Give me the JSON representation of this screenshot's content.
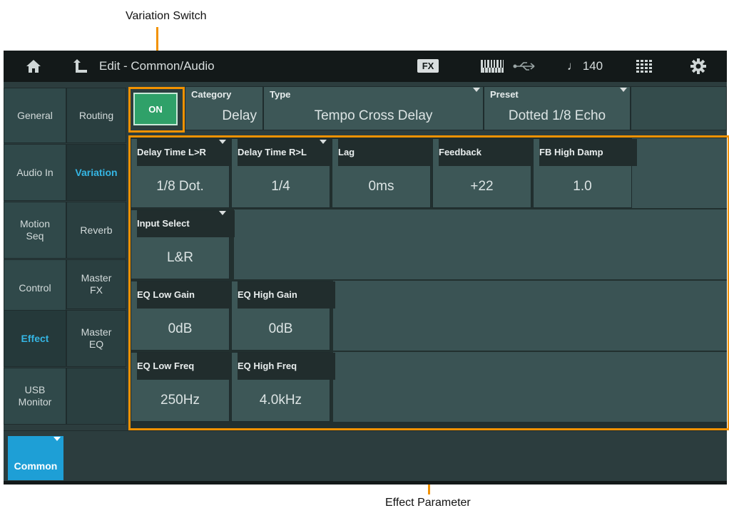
{
  "annotations": {
    "variation_switch": "Variation Switch",
    "effect_parameter": "Effect Parameter"
  },
  "topbar": {
    "title": "Edit - Common/Audio",
    "fx_badge": "FX",
    "tempo": "♩ 140",
    "icons": [
      "home-icon",
      "back-arrow-icon",
      "keyboard-icon",
      "usb-icon",
      "grid-icon",
      "gear-icon"
    ]
  },
  "left_tabs": [
    {
      "label": "General",
      "active": false
    },
    {
      "label": "Audio In",
      "active": false
    },
    {
      "label": "Motion\nSeq",
      "active": false
    },
    {
      "label": "Control",
      "active": false
    },
    {
      "label": "Effect",
      "active": true
    },
    {
      "label": "USB\nMonitor",
      "active": false
    }
  ],
  "sub_tabs": [
    {
      "label": "Routing",
      "active": false
    },
    {
      "label": "Variation",
      "active": true
    },
    {
      "label": "Reverb",
      "active": false
    },
    {
      "label": "Master\nFX",
      "active": false
    },
    {
      "label": "Master\nEQ",
      "active": false
    }
  ],
  "switch": {
    "label": "ON"
  },
  "header": {
    "category": {
      "label": "Category",
      "value": "Delay"
    },
    "type": {
      "label": "Type",
      "value": "Tempo Cross Delay"
    },
    "preset": {
      "label": "Preset",
      "value": "Dotted 1/8 Echo"
    }
  },
  "params": {
    "delay_lr": {
      "label": "Delay Time L>R",
      "value": "1/8 Dot."
    },
    "delay_rl": {
      "label": "Delay Time R>L",
      "value": "1/4"
    },
    "lag": {
      "label": "Lag",
      "value": "0ms"
    },
    "feedback": {
      "label": "Feedback",
      "value": "+22"
    },
    "fb_high_damp": {
      "label": "FB High Damp",
      "value": "1.0"
    },
    "input_select": {
      "label": "Input Select",
      "value": "L&R"
    },
    "eq_low_gain": {
      "label": "EQ Low Gain",
      "value": "0dB"
    },
    "eq_high_gain": {
      "label": "EQ High Gain",
      "value": "0dB"
    },
    "eq_low_freq": {
      "label": "EQ Low Freq",
      "value": "250Hz"
    },
    "eq_high_freq": {
      "label": "EQ High Freq",
      "value": "4.0kHz"
    }
  },
  "bottom": {
    "common_label": "Common"
  },
  "colors": {
    "accent": "#f29200",
    "active_text": "#35b6e4",
    "on_button": "#2fa169",
    "common_button": "#1e9fd6"
  }
}
